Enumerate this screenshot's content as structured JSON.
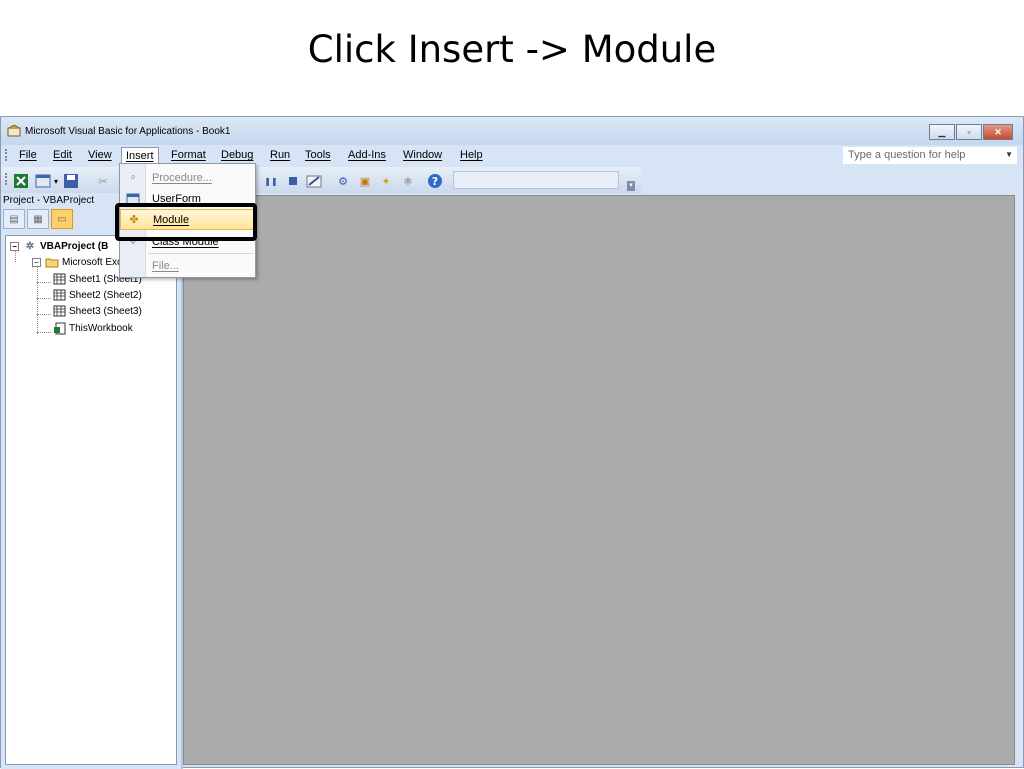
{
  "slide": {
    "title": "Click Insert -> Module"
  },
  "window": {
    "title": "Microsoft Visual Basic for Applications - Book1",
    "buttons": {
      "minimize": "▁",
      "restore": "▫",
      "close": "✕"
    }
  },
  "menubar": {
    "items": [
      {
        "label": "File"
      },
      {
        "label": "Edit"
      },
      {
        "label": "View"
      },
      {
        "label": "Insert"
      },
      {
        "label": "Format"
      },
      {
        "label": "Debug"
      },
      {
        "label": "Run"
      },
      {
        "label": "Tools"
      },
      {
        "label": "Add-Ins"
      },
      {
        "label": "Window"
      },
      {
        "label": "Help"
      }
    ],
    "help_placeholder": "Type a question for help"
  },
  "project_panel": {
    "title": "Project - VBAProject",
    "tree": {
      "root": "VBAProject (B",
      "folder": "Microsoft Exc",
      "sheets": [
        "Sheet1 (Sheet1)",
        "Sheet2 (Sheet2)",
        "Sheet3 (Sheet3)"
      ],
      "workbook": "ThisWorkbook"
    }
  },
  "insert_menu": {
    "items": [
      {
        "label": "Procedure...",
        "icon": "procedure-icon",
        "enabled": false
      },
      {
        "label": "UserForm",
        "icon": "userform-icon",
        "enabled": true
      },
      {
        "label": "Module",
        "icon": "module-icon",
        "enabled": true,
        "highlighted": true
      },
      {
        "label": "Class Module",
        "icon": "class-module-icon",
        "enabled": true
      },
      {
        "label": "File...",
        "icon": "",
        "enabled": false
      }
    ]
  },
  "colors": {
    "chrome": "#d6e4f5",
    "workspace": "#ababab",
    "highlight": "#ffe59a",
    "callout_border": "#000000"
  }
}
